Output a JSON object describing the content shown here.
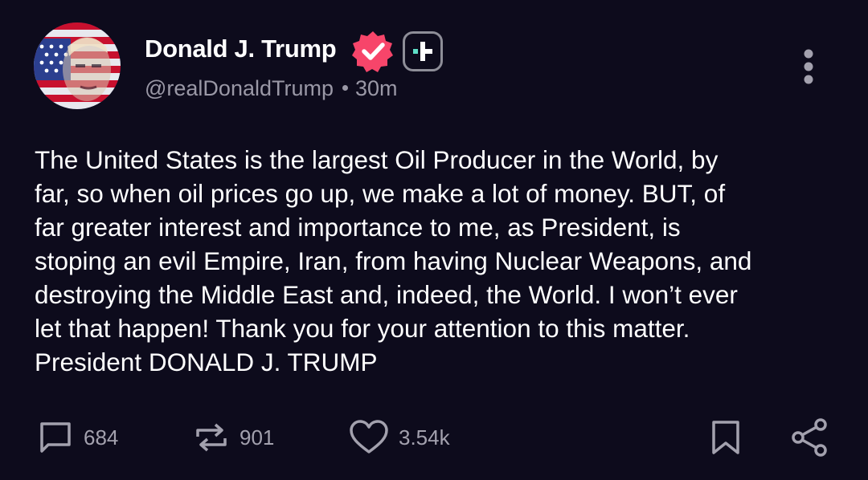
{
  "post": {
    "author": {
      "display_name": "Donald J. Trump",
      "handle": "@realDonaldTrump",
      "avatar_icon": "flag-portrait-avatar",
      "verified_icon": "verified-badge-icon",
      "plus_icon": "plus-badge-icon"
    },
    "timestamp": "30m",
    "text": "The United States is the largest Oil Producer in the World, by\nfar, so when oil prices go up, we make a lot of money. BUT, of\nfar greater interest and importance to me, as President, is\nstoping an evil Empire, Iran, from having Nuclear Weapons, and\ndestroying the Middle East and, indeed, the World. I won’t ever\nlet that happen! Thank you for your attention to this matter.\nPresident DONALD J. TRUMP",
    "actions": {
      "replies": "684",
      "reposts": "901",
      "likes": "3.54k"
    }
  },
  "colors": {
    "background": "#0d0b1c",
    "verified": "#f7456a",
    "muted_text": "#9a98a6",
    "plus_accent": "#5fe0c8"
  }
}
